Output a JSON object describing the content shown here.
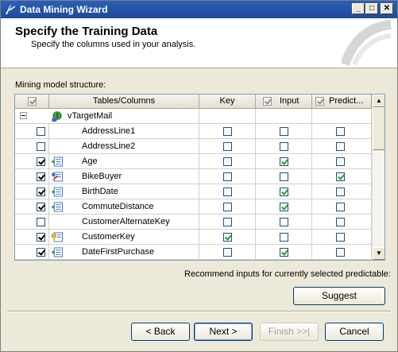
{
  "window": {
    "title": "Data Mining Wizard"
  },
  "header": {
    "title": "Specify the Training Data",
    "subtitle": "Specify the columns used in your analysis."
  },
  "grid_label": "Mining model structure:",
  "columns": {
    "name": "Tables/Columns",
    "key": "Key",
    "input": "Input",
    "predict": "Predict..."
  },
  "table": {
    "name": "vTargetMail"
  },
  "rows": [
    {
      "name": "AddressLine1",
      "include": false,
      "icon": "",
      "key": false,
      "input": false,
      "predict": false
    },
    {
      "name": "AddressLine2",
      "include": false,
      "icon": "",
      "key": false,
      "input": false,
      "predict": false
    },
    {
      "name": "Age",
      "include": true,
      "icon": "column-icon",
      "key": false,
      "input": true,
      "predict": false
    },
    {
      "name": "BikeBuyer",
      "include": true,
      "icon": "predictable-column-icon",
      "key": false,
      "input": false,
      "predict": true
    },
    {
      "name": "BirthDate",
      "include": true,
      "icon": "column-icon",
      "key": false,
      "input": true,
      "predict": false
    },
    {
      "name": "CommuteDistance",
      "include": true,
      "icon": "column-icon",
      "key": false,
      "input": true,
      "predict": false
    },
    {
      "name": "CustomerAlternateKey",
      "include": false,
      "icon": "",
      "key": false,
      "input": false,
      "predict": false
    },
    {
      "name": "CustomerKey",
      "include": true,
      "icon": "key-column-icon",
      "key": true,
      "input": false,
      "predict": false
    },
    {
      "name": "DateFirstPurchase",
      "include": true,
      "icon": "column-icon",
      "key": false,
      "input": true,
      "predict": false
    }
  ],
  "recommend_label": "Recommend inputs for currently selected predictable:",
  "buttons": {
    "suggest": "Suggest",
    "back": "< Back",
    "next": "Next >",
    "finish": "Finish >>|",
    "cancel": "Cancel"
  },
  "colors": {
    "title_bar": "#2b5fb8",
    "check_green": "#21a121",
    "dialog_bg": "#ece9d8"
  }
}
